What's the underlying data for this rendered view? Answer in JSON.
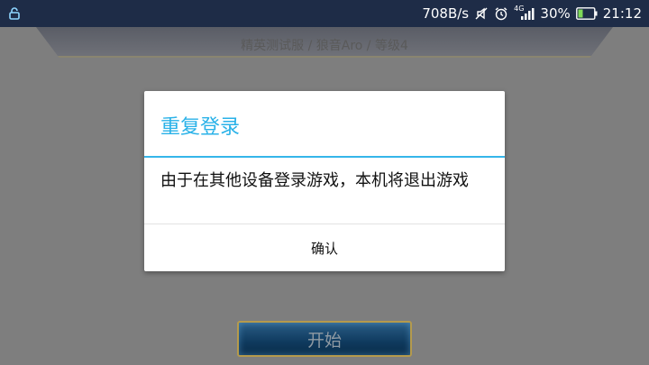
{
  "status_bar": {
    "left_icon": "notification-app-icon",
    "net_speed": "708B/s",
    "icons": [
      "mute-icon",
      "alarm-clock-icon",
      "signal-icon",
      "battery-charging-icon"
    ],
    "network_type": "4G",
    "battery_percent": "30%",
    "battery_level": 0.3,
    "time": "21:12"
  },
  "game": {
    "server_info": "精英测试服 / 狼音Aro / 等级4",
    "start_label": "开始"
  },
  "dialog": {
    "title": "重复登录",
    "message": "由于在其他设备登录游戏，本机将退出游戏",
    "confirm_label": "确认",
    "accent_color": "#2ab2e8"
  }
}
